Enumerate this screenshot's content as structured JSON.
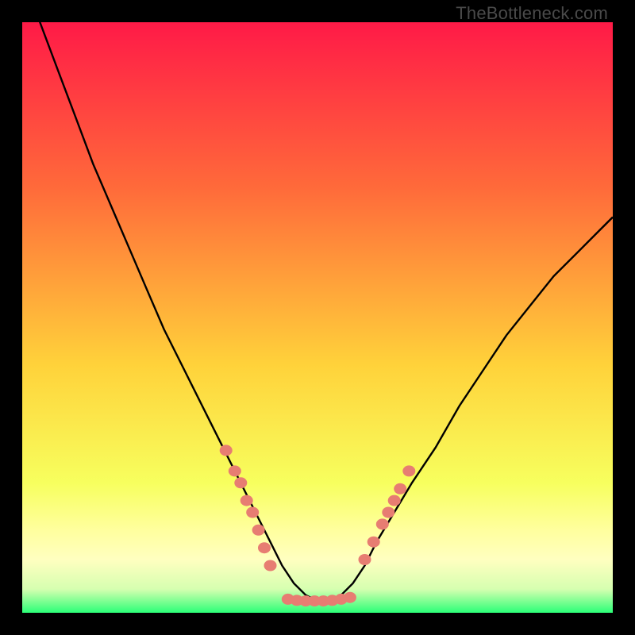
{
  "watermark": "TheBottleneck.com",
  "colors": {
    "grad_top": "#ff1a47",
    "grad_mid1": "#ff6a3a",
    "grad_mid2": "#ffd23a",
    "grad_mid3": "#f7ff5e",
    "grad_band": "#ffff9e",
    "grad_bottom": "#2bff77",
    "curve": "#000000",
    "marker": "#e77d72",
    "frame_bg": "#000000"
  },
  "chart_data": {
    "type": "line",
    "title": "",
    "xlabel": "",
    "ylabel": "",
    "xlim": [
      0,
      100
    ],
    "ylim": [
      0,
      100
    ],
    "curve": {
      "name": "bottleneck-curve",
      "x": [
        0,
        3,
        6,
        9,
        12,
        15,
        18,
        21,
        24,
        27,
        30,
        33,
        36,
        38,
        40,
        42,
        44,
        46,
        48,
        50,
        52,
        54,
        56,
        58,
        60,
        63,
        66,
        70,
        74,
        78,
        82,
        86,
        90,
        94,
        98,
        100
      ],
      "y": [
        108,
        100,
        92,
        84,
        76,
        69,
        62,
        55,
        48,
        42,
        36,
        30,
        24,
        20,
        16,
        12,
        8,
        5,
        3,
        2,
        2,
        3,
        5,
        8,
        12,
        17,
        22,
        28,
        35,
        41,
        47,
        52,
        57,
        61,
        65,
        67
      ]
    },
    "series": [
      {
        "name": "left-cluster",
        "type": "scatter",
        "x": [
          34.5,
          36.0,
          37.0,
          38.0,
          39.0,
          40.0,
          41.0,
          42.0
        ],
        "y": [
          27.5,
          24.0,
          22.0,
          19.0,
          17.0,
          14.0,
          11.0,
          8.0
        ]
      },
      {
        "name": "bottom-cluster",
        "type": "scatter",
        "x": [
          45.0,
          46.5,
          48.0,
          49.5,
          51.0,
          52.5,
          54.0,
          55.5
        ],
        "y": [
          2.3,
          2.1,
          2.0,
          2.0,
          2.0,
          2.1,
          2.3,
          2.6
        ]
      },
      {
        "name": "right-cluster",
        "type": "scatter",
        "x": [
          58.0,
          59.5,
          61.0,
          62.0,
          63.0,
          64.0,
          65.5
        ],
        "y": [
          9.0,
          12.0,
          15.0,
          17.0,
          19.0,
          21.0,
          24.0
        ]
      }
    ],
    "gradient_bands_y": [
      0,
      58,
      78,
      88,
      93,
      96,
      100
    ]
  }
}
